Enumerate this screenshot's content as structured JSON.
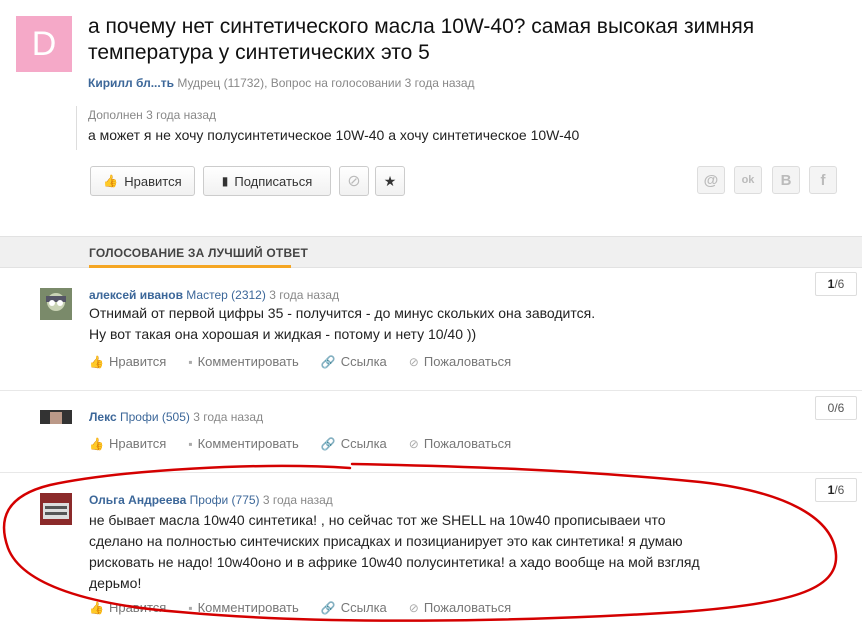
{
  "question": {
    "avatar_letter": "D",
    "title": "а почему нет синтетического масла 10W-40? самая высокая зимняя температура у синтетических это 5",
    "author": "Кирилл бл...ть",
    "meta": "Мудрец (11732), Вопрос на голосовании 3 года назад",
    "addition_label": "Дополнен 3 года назад",
    "addition_text": "а может я не хочу полусинтетическое 10W-40 а хочу синтетическое 10W-40"
  },
  "toolbar": {
    "like_label": "Нравится",
    "subscribe_label": "Подписаться",
    "ban_glyph": "⊘",
    "star_glyph": "★"
  },
  "share": [
    "@",
    "ok",
    "B",
    "f"
  ],
  "section": {
    "title": "Голосование за лучший ответ"
  },
  "answer_actions": {
    "like": "Нравится",
    "comment": "Комментировать",
    "link": "Ссылка",
    "report": "Пожаловаться"
  },
  "answers": [
    {
      "author": "алексей иванов",
      "rank": "Мастер (2312)",
      "time": "3 года назад",
      "text": [
        "Отнимай от первой цифры 35 - получится - до минус скольких она заводится.",
        "Ну вот такая она хорошая и жидкая - потому и нету 10/40 ))"
      ],
      "votes": "1",
      "total": "/6"
    },
    {
      "author": "Лекс",
      "rank": "Профи (505)",
      "time": "3 года назад",
      "text": [],
      "votes": "0",
      "total": "/6"
    },
    {
      "author": "Ольга Андреева",
      "rank": "Профи (775)",
      "time": "3 года назад",
      "text": [
        "не бывает масла 10w40 синтетика! , но сейчас тот же SHELL на 10w40 прописываеи что",
        "сделано на полностью синтечиских присадках и позицианирует это как синтетика! я думаю",
        "рисковать не надо! 10w40оно и в африке 10w40 полусинтетика! а хадо вообще на мой взгляд",
        "дерьмо!"
      ],
      "votes": "1",
      "total": "/6"
    }
  ],
  "colors": {
    "accent": "#f5a623",
    "link": "#3c6799",
    "annotation": "#d40000",
    "avatar_bg": "#f5a9c8"
  }
}
